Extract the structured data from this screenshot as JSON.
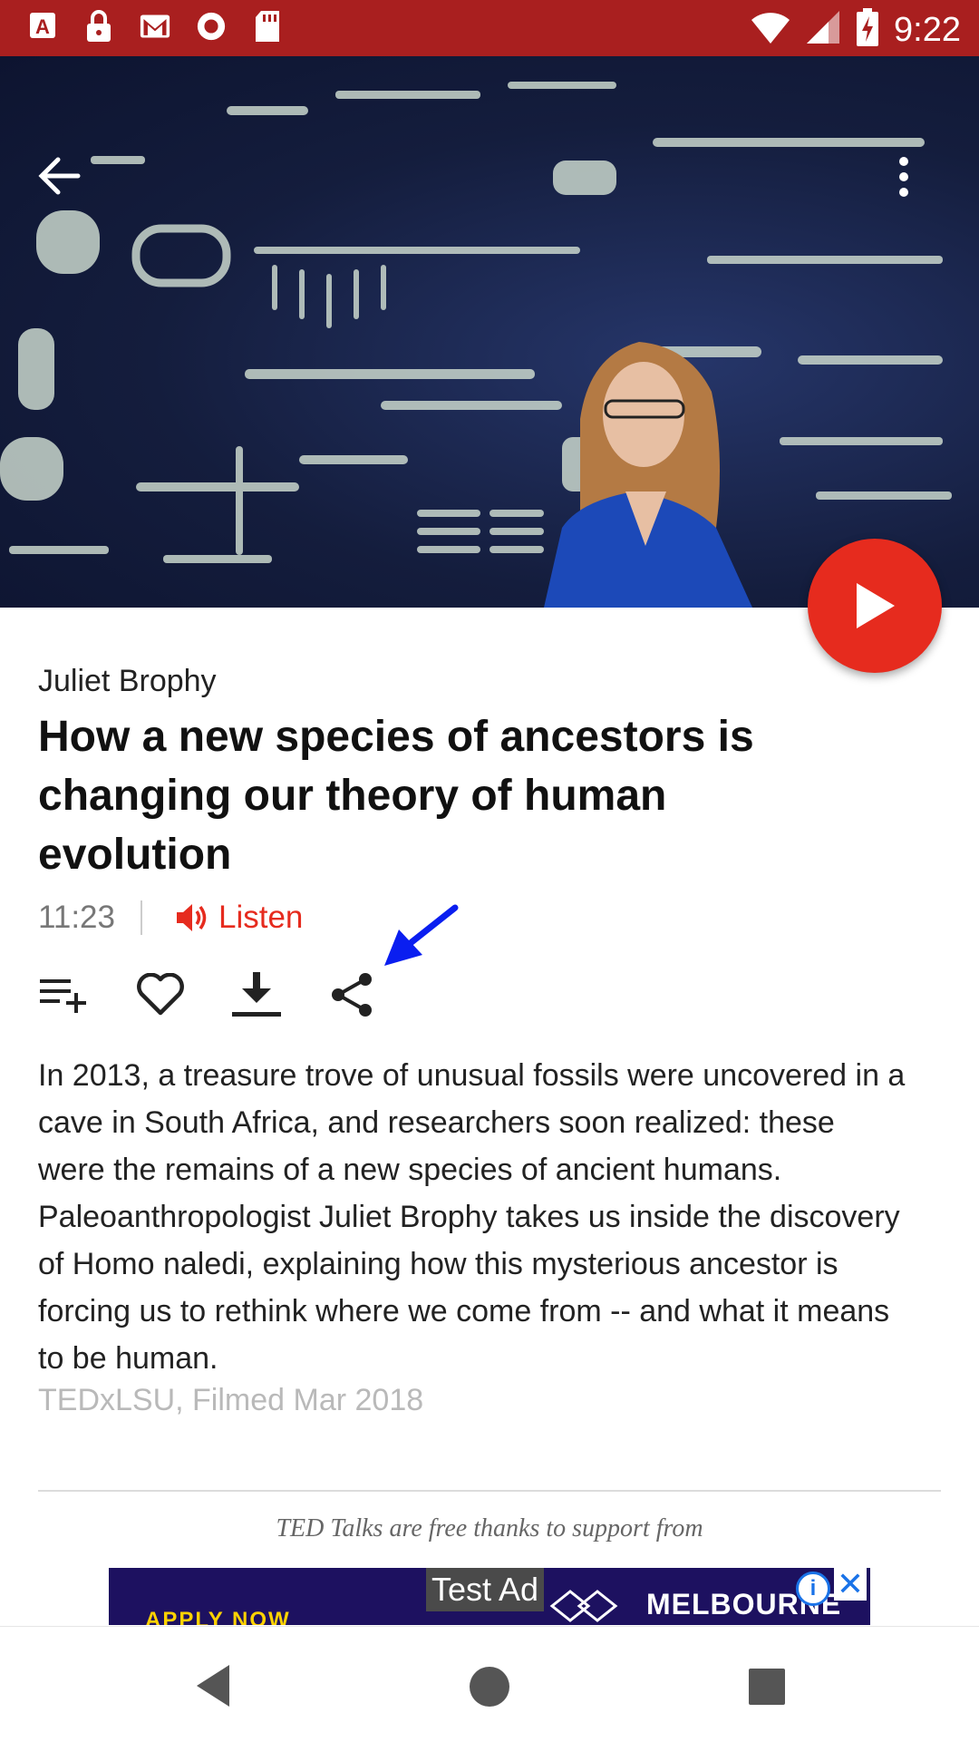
{
  "status_bar": {
    "time": "9:22",
    "left_icons": [
      "app-a-icon",
      "lock-icon",
      "gmail-icon",
      "record-icon",
      "sd-card-icon"
    ],
    "right_icons": [
      "wifi-icon",
      "signal-icon",
      "battery-charging-icon"
    ]
  },
  "hero": {
    "back_icon": "back-arrow-icon",
    "menu_icon": "more-vert-icon",
    "play_icon": "play-icon"
  },
  "talk": {
    "speaker": "Juliet Brophy",
    "title": "How a new species of ancestors is changing our theory of human evolution",
    "duration": "11:23",
    "listen_label": "Listen",
    "description": "In 2013, a treasure trove of unusual fossils were uncovered in a cave in South Africa, and researchers soon realized: these were the remains of a new species of ancient humans. Paleoanthropologist Juliet Brophy takes us inside the discovery of Homo naledi, explaining how this mysterious ancestor is forcing us to rethink where we come from -- and what it means to be human.",
    "event": "TEDxLSU, Filmed Mar 2018"
  },
  "actions": [
    "add-to-playlist-icon",
    "favorite-icon",
    "download-icon",
    "share-icon"
  ],
  "support_text": "TED Talks are free thanks to support from",
  "ad": {
    "label": "Test Ad",
    "brand": "MELBOURNE",
    "cta": "APPLY NOW",
    "info": "i",
    "close": "✕"
  },
  "colors": {
    "status_bar": "#a91f1f",
    "accent": "#e62b1e",
    "annotation_arrow": "#0a1ef0"
  }
}
